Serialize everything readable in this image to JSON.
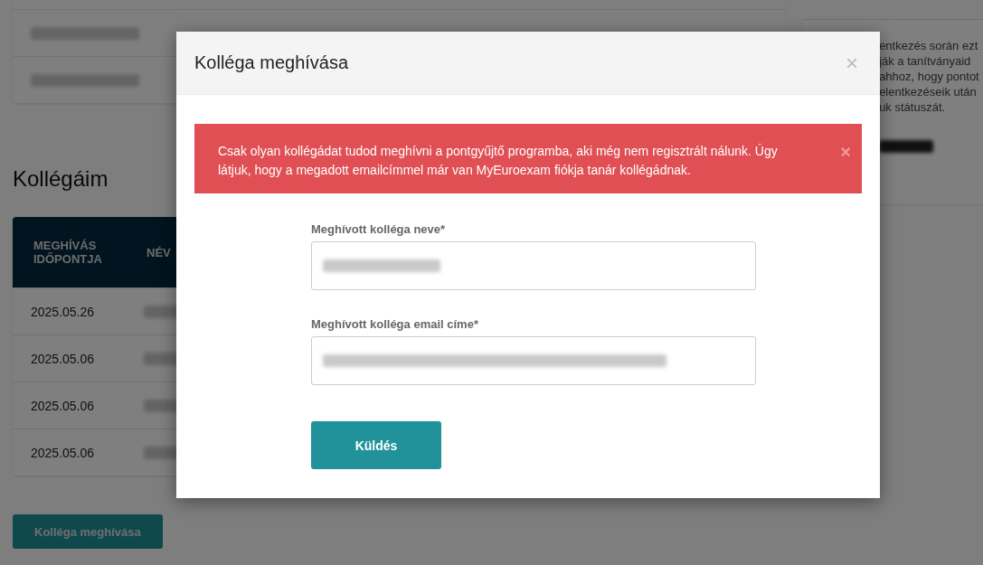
{
  "top_card": {
    "rows": [
      {
        "kind": "redacted"
      },
      {
        "kind": "redacted"
      }
    ]
  },
  "section_title": "Kollégáim",
  "table": {
    "columns": [
      "MEGHÍVÁS IDŐPONTJA",
      "NÉV"
    ],
    "rows": [
      {
        "date": "2025.05.26"
      },
      {
        "date": "2025.05.06"
      },
      {
        "date": "2025.05.06"
      },
      {
        "date": "2025.05.06"
      }
    ]
  },
  "invite_button": "Kolléga meghívása",
  "side_panel": {
    "lines": [
      "entkezés során ezt",
      "ják a tanítványaid",
      "ahhoz, hogy pontot",
      "elentkezéseik után",
      "uk státuszát."
    ]
  },
  "modal": {
    "title": "Kolléga meghívása",
    "close": "×",
    "alert": {
      "text": "Csak olyan kollégádat tudod meghívni a pontgyűjtő programba, aki még nem regisztrált nálunk. Úgy látjuk, hogy a megadott emailcímmel már van MyEuroexam fiókja tanár kollégádnak.",
      "close": "×"
    },
    "fields": [
      {
        "label": "Meghívott kolléga neve*",
        "kind": "short"
      },
      {
        "label": "Meghívott kolléga email címe*",
        "kind": "long"
      }
    ],
    "submit": "Küldés"
  }
}
